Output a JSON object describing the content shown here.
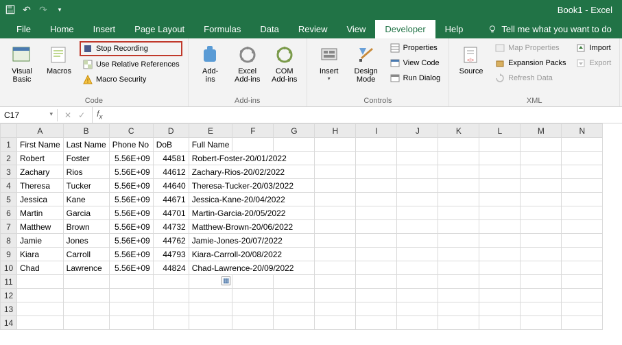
{
  "titlebar": {
    "title": "Book1 - Excel"
  },
  "tabs": [
    "File",
    "Home",
    "Insert",
    "Page Layout",
    "Formulas",
    "Data",
    "Review",
    "View",
    "Developer",
    "Help"
  ],
  "activeTab": "Developer",
  "tellme": "Tell me what you want to do",
  "ribbon": {
    "code": {
      "visual_basic": "Visual\nBasic",
      "macros": "Macros",
      "stop_recording": "Stop Recording",
      "use_relative": "Use Relative References",
      "macro_security": "Macro Security",
      "label": "Code"
    },
    "addins": {
      "addins": "Add-\nins",
      "excel_addins": "Excel\nAdd-ins",
      "com_addins": "COM\nAdd-ins",
      "label": "Add-ins"
    },
    "controls": {
      "insert": "Insert",
      "design_mode": "Design\nMode",
      "properties": "Properties",
      "view_code": "View Code",
      "run_dialog": "Run Dialog",
      "label": "Controls"
    },
    "xml": {
      "source": "Source",
      "map_props": "Map Properties",
      "expansion_packs": "Expansion Packs",
      "refresh_data": "Refresh Data",
      "import": "Import",
      "export": "Export",
      "label": "XML"
    }
  },
  "formula_bar": {
    "namebox": "C17",
    "formula": ""
  },
  "columns": [
    "A",
    "B",
    "C",
    "D",
    "E",
    "F",
    "G",
    "H",
    "I",
    "J",
    "K",
    "L",
    "M",
    "N"
  ],
  "headers": {
    "A": "First Name",
    "B": "Last Name",
    "C": "Phone No",
    "D": "DoB",
    "E": "Full Name"
  },
  "rows": [
    {
      "A": "Robert",
      "B": "Foster",
      "C": "5.56E+09",
      "D": "44581",
      "E": "Robert-Foster-20/01/2022"
    },
    {
      "A": "Zachary",
      "B": "Rios",
      "C": "5.56E+09",
      "D": "44612",
      "E": "Zachary-Rios-20/02/2022"
    },
    {
      "A": "Theresa",
      "B": "Tucker",
      "C": "5.56E+09",
      "D": "44640",
      "E": "Theresa-Tucker-20/03/2022"
    },
    {
      "A": "Jessica",
      "B": "Kane",
      "C": "5.56E+09",
      "D": "44671",
      "E": "Jessica-Kane-20/04/2022"
    },
    {
      "A": "Martin",
      "B": "Garcia",
      "C": "5.56E+09",
      "D": "44701",
      "E": "Martin-Garcia-20/05/2022"
    },
    {
      "A": "Matthew",
      "B": "Brown",
      "C": "5.56E+09",
      "D": "44732",
      "E": "Matthew-Brown-20/06/2022"
    },
    {
      "A": "Jamie",
      "B": "Jones",
      "C": "5.56E+09",
      "D": "44762",
      "E": "Jamie-Jones-20/07/2022"
    },
    {
      "A": "Kiara",
      "B": "Carroll",
      "C": "5.56E+09",
      "D": "44793",
      "E": "Kiara-Carroll-20/08/2022"
    },
    {
      "A": "Chad",
      "B": "Lawrence",
      "C": "5.56E+09",
      "D": "44824",
      "E": "Chad-Lawrence-20/09/2022"
    }
  ],
  "totalVisibleRows": 14
}
